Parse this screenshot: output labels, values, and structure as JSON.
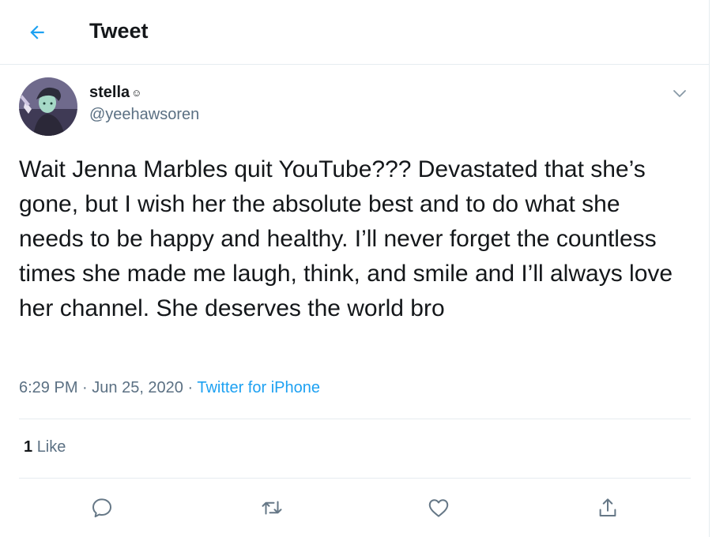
{
  "header": {
    "title": "Tweet",
    "back_icon": "arrow-left-icon"
  },
  "author": {
    "display_name": "stella",
    "name_emoji": "☺",
    "handle": "@yeehawsoren"
  },
  "tweet": {
    "text": "Wait Jenna Marbles quit YouTube??? Devastated that she’s gone, but I wish her the absolute best and to do what she needs to be happy and healthy. I’ll never forget the countless times she made me laugh, think, and smile and I’ll always love her channel. She deserves the world bro",
    "time": "6:29 PM",
    "separator": " · ",
    "date": "Jun 25, 2020",
    "source": "Twitter for iPhone"
  },
  "stats": {
    "like_count": "1",
    "like_label": "Like"
  },
  "actions": [
    "reply-icon",
    "retweet-icon",
    "like-icon",
    "share-icon"
  ],
  "colors": {
    "accent": "#1da1f2",
    "secondary_text": "#5b7083",
    "divider": "#e6ecf0",
    "action_icon": "#657786"
  }
}
